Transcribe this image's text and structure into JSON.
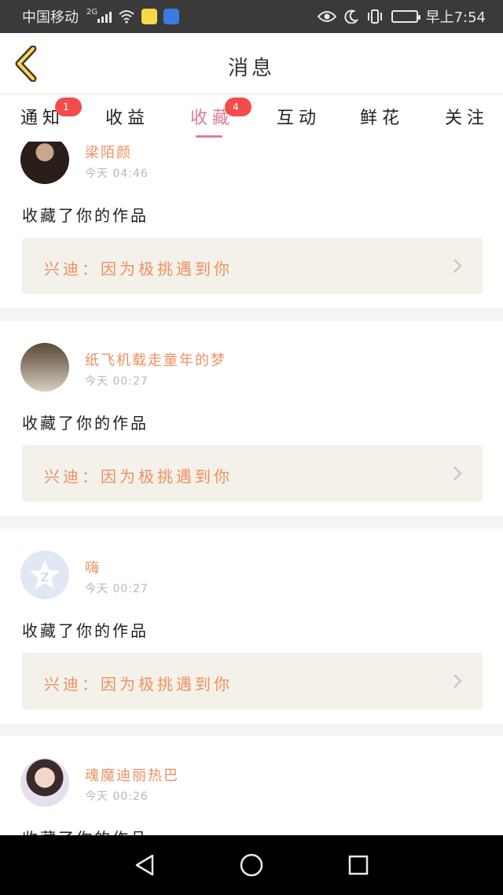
{
  "status_bar": {
    "carrier": "中国移动",
    "network": "2G",
    "time": "早上7:54"
  },
  "header": {
    "title": "消息",
    "back_icon": "chevron-left-icon"
  },
  "tabs": [
    {
      "label": "通知",
      "badge": "1"
    },
    {
      "label": "收益",
      "badge": ""
    },
    {
      "label": "收藏",
      "badge": "4",
      "active": true
    },
    {
      "label": "互动",
      "badge": ""
    },
    {
      "label": "鲜花",
      "badge": ""
    },
    {
      "label": "关注",
      "badge": ""
    }
  ],
  "messages": [
    {
      "user": "梁陌颜",
      "time": "今天 04:46",
      "action": "收藏了你的作品",
      "work": "兴迪：因为极挑遇到你"
    },
    {
      "user": "纸飞机载走童年的梦",
      "time": "今天 00:27",
      "action": "收藏了你的作品",
      "work": "兴迪：因为极挑遇到你"
    },
    {
      "user": "嗨",
      "time": "今天 00:27",
      "action": "收藏了你的作品",
      "work": "兴迪：因为极挑遇到你"
    },
    {
      "user": "魂魔迪丽热巴",
      "time": "今天 00:26",
      "action": "收藏了你的作品",
      "work": ""
    }
  ],
  "colors": {
    "accent": "#e07aa0",
    "name": "#f09060",
    "badge": "#f44b4b",
    "work_bg": "#f3f1ea"
  }
}
